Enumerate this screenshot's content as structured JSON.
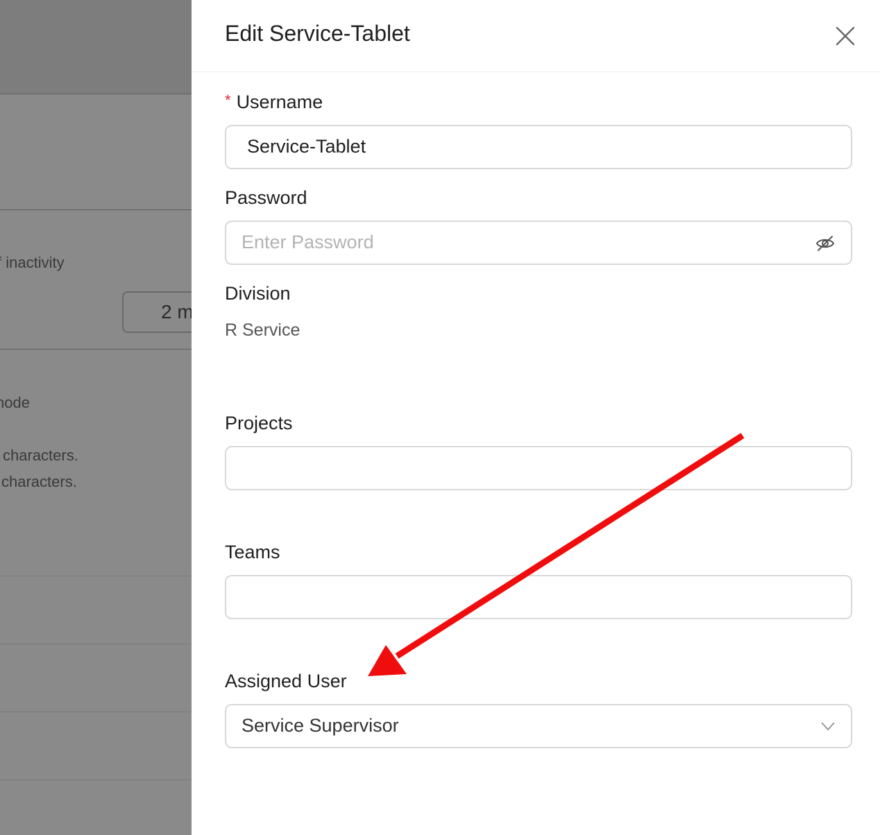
{
  "background": {
    "texts": [
      "f inactivity",
      "2 m",
      "node",
      "characters.",
      "characters."
    ]
  },
  "drawer": {
    "title": "Edit Service-Tablet",
    "username": {
      "label": "Username",
      "required_mark": "*",
      "value": "Service-Tablet"
    },
    "password": {
      "label": "Password",
      "placeholder": "Enter Password"
    },
    "division": {
      "label": "Division",
      "value": "R Service"
    },
    "projects": {
      "label": "Projects",
      "value": ""
    },
    "teams": {
      "label": "Teams",
      "value": ""
    },
    "assigned_user": {
      "label": "Assigned User",
      "value": "Service Supervisor"
    }
  },
  "colors": {
    "required": "#e0282e",
    "annotation_arrow": "#f00d0d",
    "overlay": "#8a8a8a"
  },
  "icons": {
    "close": "close-icon",
    "password_toggle": "eye-off-icon",
    "dropdown": "chevron-down-icon"
  }
}
